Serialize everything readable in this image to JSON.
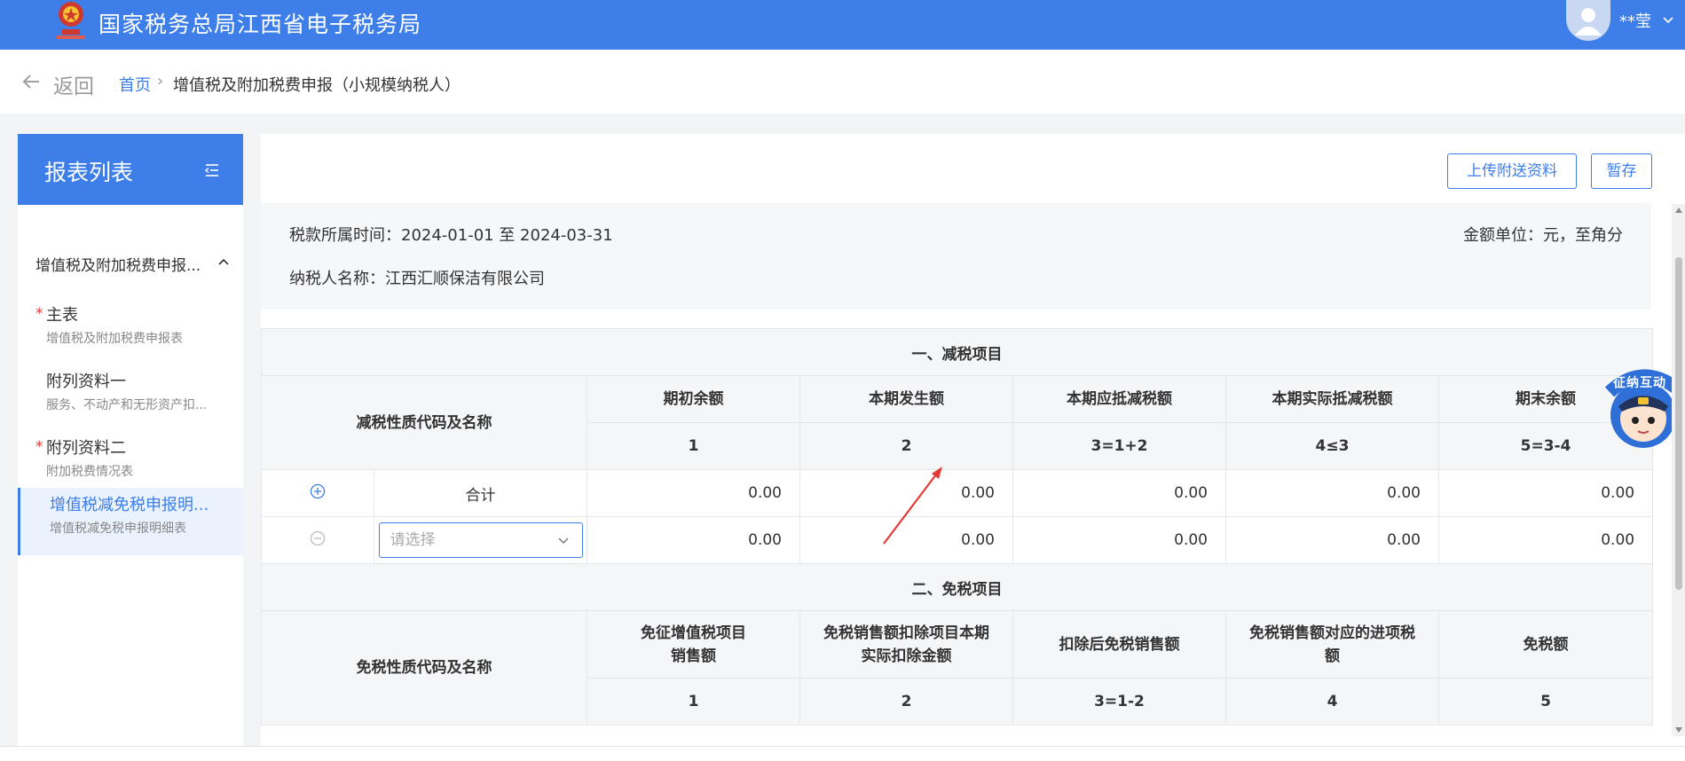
{
  "header": {
    "site_title": "国家税务总局江西省电子税务局",
    "user_name": "**莹",
    "brand_color": "#3d7ee8"
  },
  "nav": {
    "back_label": "返回",
    "breadcrumb_home": "首页",
    "breadcrumb_sep": "›",
    "breadcrumb_current": "增值税及附加税费申报（小规模纳税人）"
  },
  "sidebar": {
    "title": "报表列表",
    "group_label": "增值税及附加税费申报...",
    "items": [
      {
        "required": "*",
        "label": "主表",
        "sub": "增值税及附加税费申报表"
      },
      {
        "required": "",
        "label": "附列资料一",
        "sub": "服务、不动产和无形资产扣..."
      },
      {
        "required": "*",
        "label": "附列资料二",
        "sub": "附加税费情况表"
      },
      {
        "required": "",
        "label": "增值税减免税申报明...",
        "sub": "增值税减免税申报明细表"
      }
    ]
  },
  "toolbar": {
    "upload_label": "上传附送资料",
    "save_label": "暂存"
  },
  "info": {
    "period": "税款所属时间：2024-01-01 至 2024-03-31",
    "unit": "金额单位：元，至角分",
    "payer": "纳税人名称：江西汇顺保洁有限公司"
  },
  "table": {
    "section1_title": "一、减税项目",
    "section1_code_header": "减税性质代码及名称",
    "section1_headers": [
      "期初余额",
      "本期发生额",
      "本期应抵减税额",
      "本期实际抵减税额",
      "期末余额"
    ],
    "section1_formulas": [
      "1",
      "2",
      "3=1+2",
      "4≤3",
      "5=3-4"
    ],
    "total_label": "合计",
    "total_values": [
      "0.00",
      "0.00",
      "0.00",
      "0.00",
      "0.00"
    ],
    "row_select_placeholder": "请选择",
    "row_values": [
      "0.00",
      "0.00",
      "0.00",
      "0.00",
      "0.00"
    ],
    "section2_title": "二、免税项目",
    "section2_code_header": "免税性质代码及名称",
    "section2_headers": [
      "免征增值税项目\n销售额",
      "免税销售额扣除项目本期\n实际扣除金额",
      "扣除后免税销售额",
      "免税销售额对应的进项税\n额",
      "免税额"
    ],
    "section2_formulas": [
      "1",
      "2",
      "3=1-2",
      "4",
      "5"
    ]
  },
  "helper": {
    "badge_text": "征纳互动",
    "icon": "tax-officer-icon"
  }
}
